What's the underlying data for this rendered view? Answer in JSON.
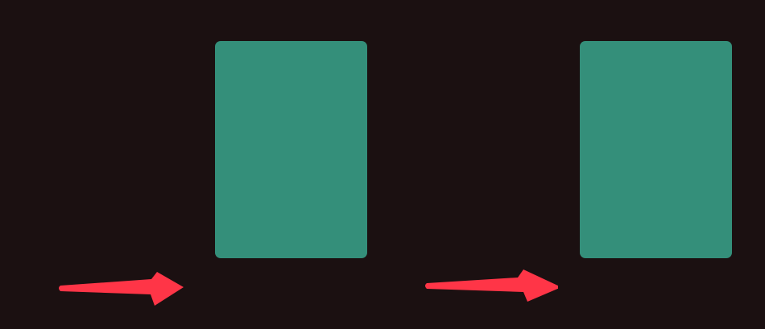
{
  "canvas": {
    "background_color": "#1b1011"
  },
  "cards": [
    {
      "name": "card-left",
      "color": "#348f7a"
    },
    {
      "name": "card-right",
      "color": "#348f7a"
    }
  ],
  "annotations": {
    "arrow_color": "#ff3547",
    "arrows": [
      {
        "name": "arrow-left",
        "icon": "right-arrow-icon",
        "points_to": "card-left"
      },
      {
        "name": "arrow-right",
        "icon": "right-arrow-icon",
        "points_to": "card-right"
      }
    ]
  }
}
